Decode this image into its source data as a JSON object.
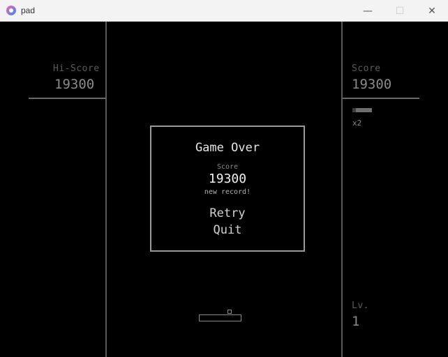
{
  "window": {
    "title": "pad",
    "min_glyph": "—",
    "max_glyph": "☐",
    "close_glyph": "✕",
    "accent": "#ff5fa2"
  },
  "hud": {
    "hiscore_label": "Hi-Score",
    "hiscore_value": "19300",
    "score_label": "Score",
    "score_value": "19300",
    "lives_text": "x2",
    "level_label": "Lv.",
    "level_value": "1"
  },
  "modal": {
    "title": "Game Over",
    "score_label": "Score",
    "score_value": "19300",
    "record_text": "new record!",
    "retry_label": "Retry",
    "quit_label": "Quit"
  }
}
